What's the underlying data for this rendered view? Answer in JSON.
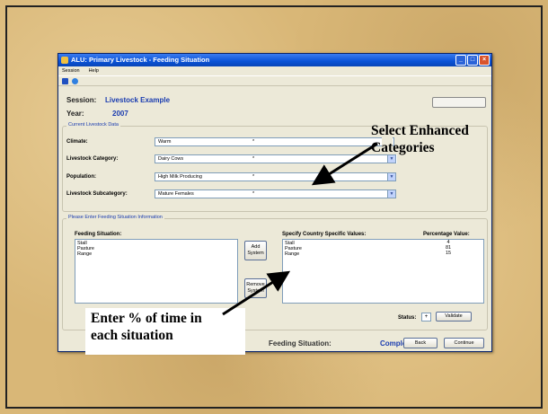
{
  "window": {
    "title": "ALU: Primary Livestock - Feeding Situation",
    "menu": [
      "Session",
      "Help"
    ]
  },
  "session": {
    "label": "Session:",
    "value": "Livestock Example"
  },
  "year": {
    "label": "Year:",
    "value": "2007"
  },
  "current_data": {
    "legend": "Current Livestock Data",
    "rows": [
      {
        "label": "Climate:",
        "value": "Warm",
        "marker": "*"
      },
      {
        "label": "Livestock Category:",
        "value": "Dairy Cows",
        "marker": "*"
      },
      {
        "label": "Population:",
        "value": "High Milk Producing",
        "marker": "*"
      },
      {
        "label": "Livestock Subcategory:",
        "value": "Mature Females",
        "marker": "*"
      }
    ]
  },
  "feeding": {
    "legend": "Please Enter Feeding Situation Information",
    "situation_header": "Feeding Situation:",
    "situations": [
      "Stall",
      "Pasture",
      "Range"
    ],
    "add_button": "Add System",
    "remove_button": "Remove System",
    "specific_header": "Specify Country Specific Values:",
    "specific_values": [
      "Stall",
      "Pasture",
      "Range"
    ],
    "percentage_header": "Percentage Value:",
    "percentages": [
      "4",
      "81",
      "15"
    ]
  },
  "status": {
    "label": "Status:",
    "value": "+",
    "validate_button": "Validate"
  },
  "footer": {
    "label": "Feeding Situation:",
    "value": "Complete",
    "back_button": "Back",
    "continue_button": "Continue"
  },
  "callouts": {
    "top_line1": "Select Enhanced",
    "top_line2": "Categories",
    "bottom_line1": "Enter % of time in",
    "bottom_line2": "each situation"
  },
  "icons": [
    "app-icon",
    "minimize-icon",
    "maximize-icon",
    "close-icon",
    "save-icon",
    "help-icon",
    "chevron-down-icon"
  ]
}
